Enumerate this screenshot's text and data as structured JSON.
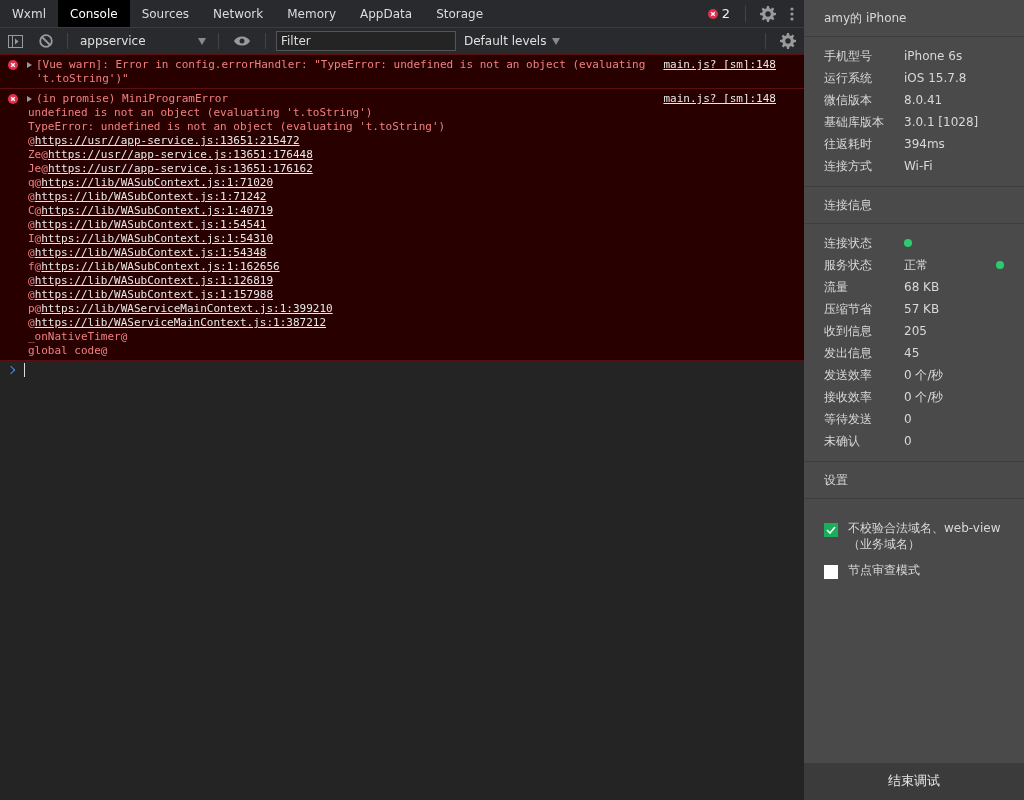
{
  "tabs": [
    {
      "label": "Wxml",
      "selected": false
    },
    {
      "label": "Console",
      "selected": true
    },
    {
      "label": "Sources",
      "selected": false
    },
    {
      "label": "Network",
      "selected": false
    },
    {
      "label": "Memory",
      "selected": false
    },
    {
      "label": "AppData",
      "selected": false
    },
    {
      "label": "Storage",
      "selected": false
    }
  ],
  "error_count": "2",
  "toolbar": {
    "context": "appservice",
    "filter": {
      "placeholder": "Filter"
    },
    "levels": "Default levels"
  },
  "messages": [
    {
      "text": "[Vue warn]: Error in config.errorHandler: \"TypeError: undefined is not an object (evaluating 't.toString')\"",
      "source": "main.js? [sm]:148",
      "expanded": false
    },
    {
      "text": "(in promise) MiniProgramError",
      "source": "main.js? [sm]:148",
      "expanded": false,
      "lines": [
        {
          "kind": "text",
          "text": "undefined is not an object (evaluating 't.toString')"
        },
        {
          "kind": "text",
          "text": "TypeError: undefined is not an object (evaluating 't.toString')"
        },
        {
          "kind": "frame",
          "fn": "@",
          "url": "https://usr//app-service.js:13651:215472"
        },
        {
          "kind": "frame",
          "fn": "Ze@",
          "url": "https://usr//app-service.js:13651:176448"
        },
        {
          "kind": "frame",
          "fn": "Je@",
          "url": "https://usr//app-service.js:13651:176162"
        },
        {
          "kind": "frame",
          "fn": "q@",
          "url": "https://lib/WASubContext.js:1:71020"
        },
        {
          "kind": "frame",
          "fn": "@",
          "url": "https://lib/WASubContext.js:1:71242"
        },
        {
          "kind": "frame",
          "fn": "C@",
          "url": "https://lib/WASubContext.js:1:40719"
        },
        {
          "kind": "frame",
          "fn": "@",
          "url": "https://lib/WASubContext.js:1:54541"
        },
        {
          "kind": "frame",
          "fn": "I@",
          "url": "https://lib/WASubContext.js:1:54310"
        },
        {
          "kind": "frame",
          "fn": "@",
          "url": "https://lib/WASubContext.js:1:54348"
        },
        {
          "kind": "frame",
          "fn": "f@",
          "url": "https://lib/WASubContext.js:1:162656"
        },
        {
          "kind": "frame",
          "fn": "@",
          "url": "https://lib/WASubContext.js:1:126819"
        },
        {
          "kind": "frame",
          "fn": "@",
          "url": "https://lib/WASubContext.js:1:157988"
        },
        {
          "kind": "frame",
          "fn": "p@",
          "url": "https://lib/WAServiceMainContext.js:1:399210"
        },
        {
          "kind": "frame",
          "fn": "@",
          "url": "https://lib/WAServiceMainContext.js:1:387212"
        },
        {
          "kind": "text",
          "text": "_onNativeTimer@"
        },
        {
          "kind": "text",
          "text": "global code@"
        }
      ]
    }
  ],
  "device": {
    "title": "amy的 iPhone",
    "info": [
      {
        "label": "手机型号",
        "value": "iPhone 6s"
      },
      {
        "label": "运行系统",
        "value": "iOS 15.7.8"
      },
      {
        "label": "微信版本",
        "value": "8.0.41"
      },
      {
        "label": "基础库版本",
        "value": "3.0.1 [1028]"
      },
      {
        "label": "往返耗时",
        "value": "394ms"
      },
      {
        "label": "连接方式",
        "value": "Wi-Fi"
      }
    ]
  },
  "connection": {
    "title": "连接信息",
    "rows": [
      {
        "label": "连接状态",
        "kind": "dot",
        "color": "#2ecc71"
      },
      {
        "label": "服务状态",
        "kind": "text-dot",
        "value": "正常",
        "color": "#2ecc71"
      },
      {
        "label": "流量",
        "kind": "text",
        "value": "68 KB"
      },
      {
        "label": "压缩节省",
        "kind": "text",
        "value": "57 KB"
      },
      {
        "label": "收到信息",
        "kind": "text",
        "value": "205"
      },
      {
        "label": "发出信息",
        "kind": "text",
        "value": "45"
      },
      {
        "label": "发送效率",
        "kind": "text",
        "value": "0 个/秒"
      },
      {
        "label": "接收效率",
        "kind": "text",
        "value": "0 个/秒"
      },
      {
        "label": "等待发送",
        "kind": "text",
        "value": "0"
      },
      {
        "label": "未确认",
        "kind": "text",
        "value": "0"
      }
    ]
  },
  "settings": {
    "title": "设置",
    "options": [
      {
        "label": "不校验合法域名、web-view（业务域名）",
        "checked": true
      },
      {
        "label": "节点审查模式",
        "checked": false
      }
    ]
  },
  "end_button": "结束调试"
}
